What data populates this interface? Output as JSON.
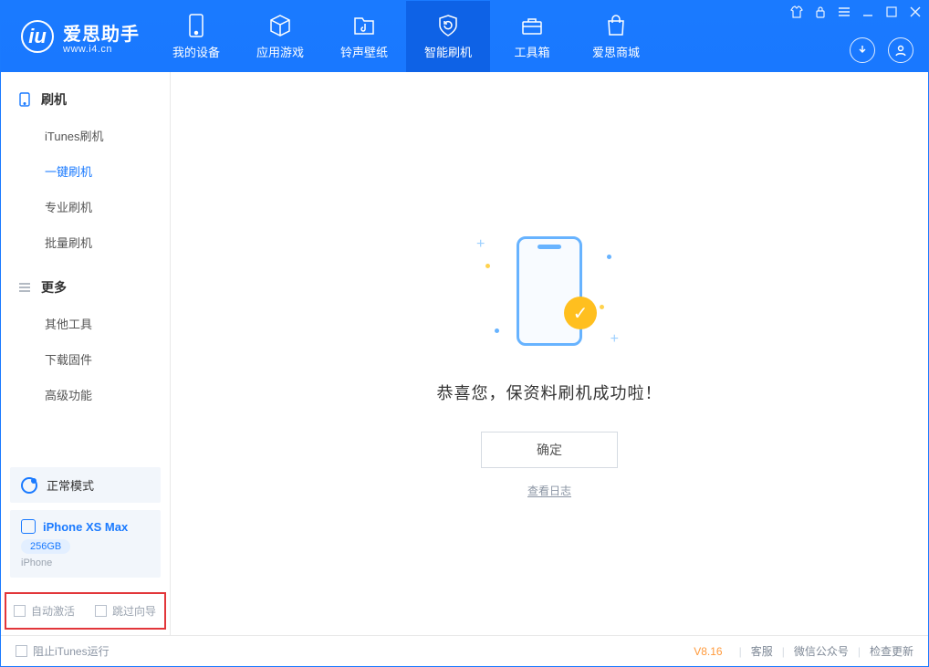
{
  "app": {
    "title": "爱思助手",
    "subtitle": "www.i4.cn"
  },
  "nav": {
    "items": [
      {
        "label": "我的设备"
      },
      {
        "label": "应用游戏"
      },
      {
        "label": "铃声壁纸"
      },
      {
        "label": "智能刷机"
      },
      {
        "label": "工具箱"
      },
      {
        "label": "爱思商城"
      }
    ],
    "active_index": 3
  },
  "sidebar": {
    "group1_title": "刷机",
    "group1_items": [
      "iTunes刷机",
      "一键刷机",
      "专业刷机",
      "批量刷机"
    ],
    "group1_active_index": 1,
    "group2_title": "更多",
    "group2_items": [
      "其他工具",
      "下载固件",
      "高级功能"
    ]
  },
  "mode": {
    "label": "正常模式"
  },
  "device": {
    "name": "iPhone XS Max",
    "storage": "256GB",
    "type": "iPhone"
  },
  "options": {
    "auto_activate": "自动激活",
    "skip_guide": "跳过向导"
  },
  "main": {
    "success_text": "恭喜您，保资料刷机成功啦！",
    "confirm_label": "确定",
    "view_log": "查看日志"
  },
  "footer": {
    "block_itunes": "阻止iTunes运行",
    "version": "V8.16",
    "links": [
      "客服",
      "微信公众号",
      "检查更新"
    ]
  }
}
